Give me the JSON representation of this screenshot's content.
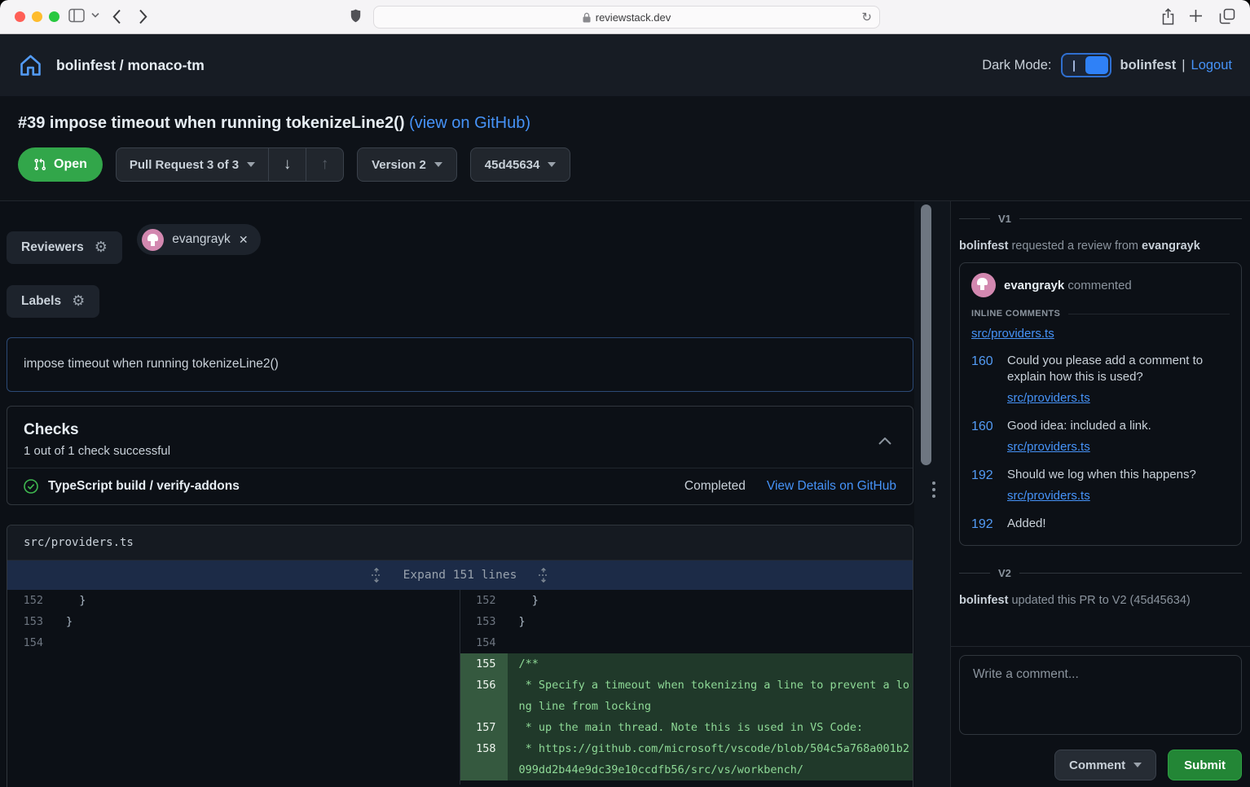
{
  "browser": {
    "url": "reviewstack.dev"
  },
  "header": {
    "repo": "bolinfest / monaco-tm",
    "dark_mode_label": "Dark Mode:",
    "username": "bolinfest",
    "separator": "|",
    "logout": "Logout"
  },
  "pr": {
    "title": "#39 impose timeout when running tokenizeLine2()",
    "view_on_github": "(view on GitHub)",
    "status": "Open",
    "stack_selector": "Pull Request 3 of 3",
    "down_arrow": "↓",
    "up_arrow": "↑",
    "version_selector": "Version 2",
    "commit_selector": "45d45634"
  },
  "review": {
    "reviewers_label": "Reviewers",
    "reviewer": "evangrayk",
    "labels_label": "Labels",
    "title_input": "impose timeout when running tokenizeLine2()"
  },
  "checks": {
    "heading": "Checks",
    "summary": "1 out of 1 check successful",
    "name": "TypeScript build / verify-addons",
    "status": "Completed",
    "details_link": "View Details on GitHub"
  },
  "diff": {
    "file": "src/providers.ts",
    "expand_label": "Expand 151 lines",
    "left": [
      {
        "num": "152",
        "code": "  }"
      },
      {
        "num": "153",
        "code": "}"
      },
      {
        "num": "154",
        "code": ""
      }
    ],
    "right": [
      {
        "num": "152",
        "code": "  }"
      },
      {
        "num": "153",
        "code": "}"
      },
      {
        "num": "154",
        "code": ""
      },
      {
        "num": "155",
        "code": "/**"
      },
      {
        "num": "156",
        "code": " * Specify a timeout when tokenizing a line to prevent a long line from locking"
      },
      {
        "num": "157",
        "code": " * up the main thread. Note this is used in VS Code:"
      },
      {
        "num": "158",
        "code": " * https://github.com/microsoft/vscode/blob/504c5a768a001b2099dd2b44e9dc39e10ccdfb56/src/vs/workbench/"
      }
    ]
  },
  "timeline": {
    "v1_label": "V1",
    "v1_user": "bolinfest",
    "v1_action": "requested a review from",
    "v1_target": "evangrayk",
    "comment_author": "evangrayk",
    "comment_action": "commented",
    "inline_comments_label": "INLINE COMMENTS",
    "file_link": "src/providers.ts",
    "items": [
      {
        "line": "160",
        "text": "Could you please add a comment to explain how this is used?",
        "link": "src/providers.ts"
      },
      {
        "line": "160",
        "text": "Good idea: included a link.",
        "link": "src/providers.ts"
      },
      {
        "line": "192",
        "text": "Should we log when this happens?",
        "link": "src/providers.ts"
      },
      {
        "line": "192",
        "text": "Added!"
      }
    ],
    "v2_label": "V2",
    "v2_user": "bolinfest",
    "v2_action": "updated this PR to V2 (45d45634)"
  },
  "composer": {
    "placeholder": "Write a comment...",
    "comment_button": "Comment",
    "submit_button": "Submit"
  },
  "colors": {
    "accent_blue": "#4693f8",
    "open_green": "#32a64a",
    "submit_green": "#238636",
    "added_line_bg": "#20392a",
    "added_gutter_bg": "#35593f",
    "header_bg": "#171c24",
    "page_bg": "#0c1016"
  }
}
